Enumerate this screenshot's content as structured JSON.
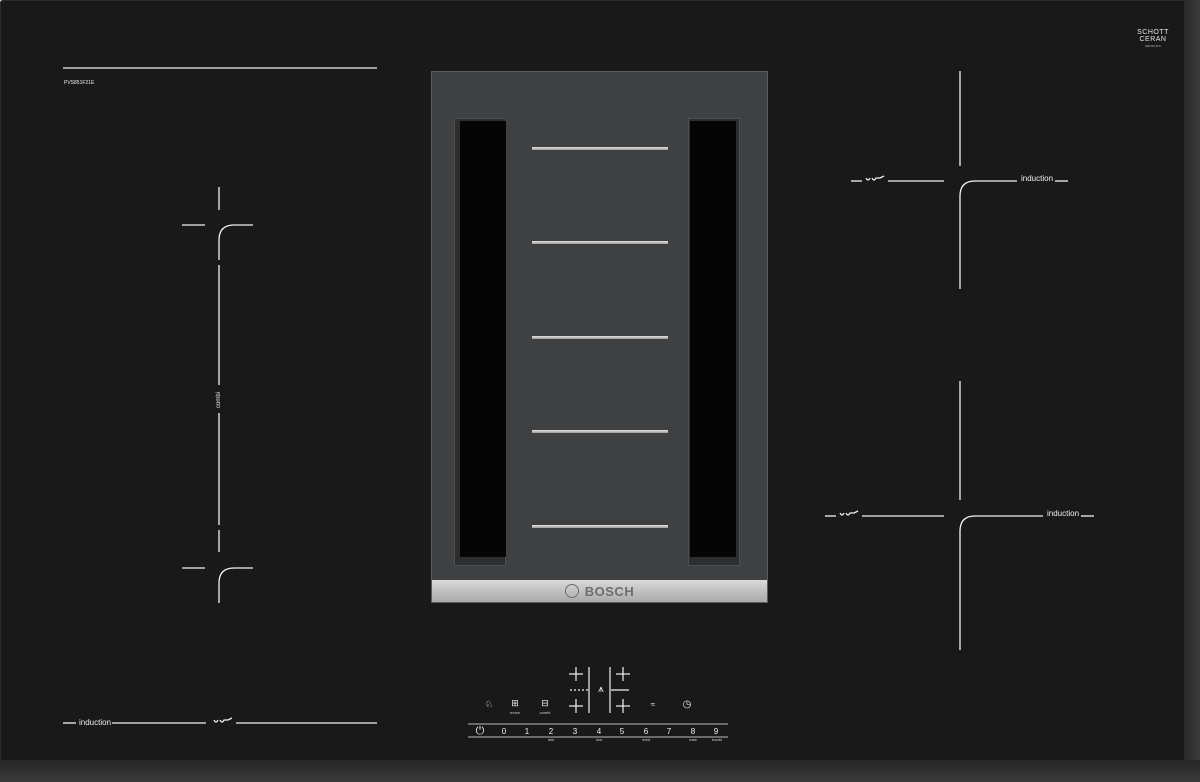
{
  "hob": {
    "model": "PVS851F21E",
    "glass_brand": {
      "line1": "SCHOTT",
      "line2": "CERAN",
      "sub": "B0O3C3T0"
    },
    "vent_brand": "BOSCH"
  },
  "zones": {
    "left_bottom_label": "induction",
    "left_vertical_label": "combi",
    "right_top_label": "induction",
    "right_bottom_label": "induction"
  },
  "controls": {
    "scale": [
      "0",
      "1",
      "2",
      "3",
      "4",
      "5",
      "6",
      "7",
      "8",
      "9"
    ],
    "scale_sub_min": "min",
    "scale_sub_low": "low",
    "scale_sub_med": "med",
    "scale_sub_max": "max",
    "scale_sub_boost": "boost",
    "move_label": "move",
    "combi_label": "combi",
    "power_icon": "power-icon",
    "childlock_icon": "child-lock-icon",
    "timer_icon": "timer-icon",
    "fan_icon": "fan-icon",
    "pan_icon": "pan-icon"
  }
}
